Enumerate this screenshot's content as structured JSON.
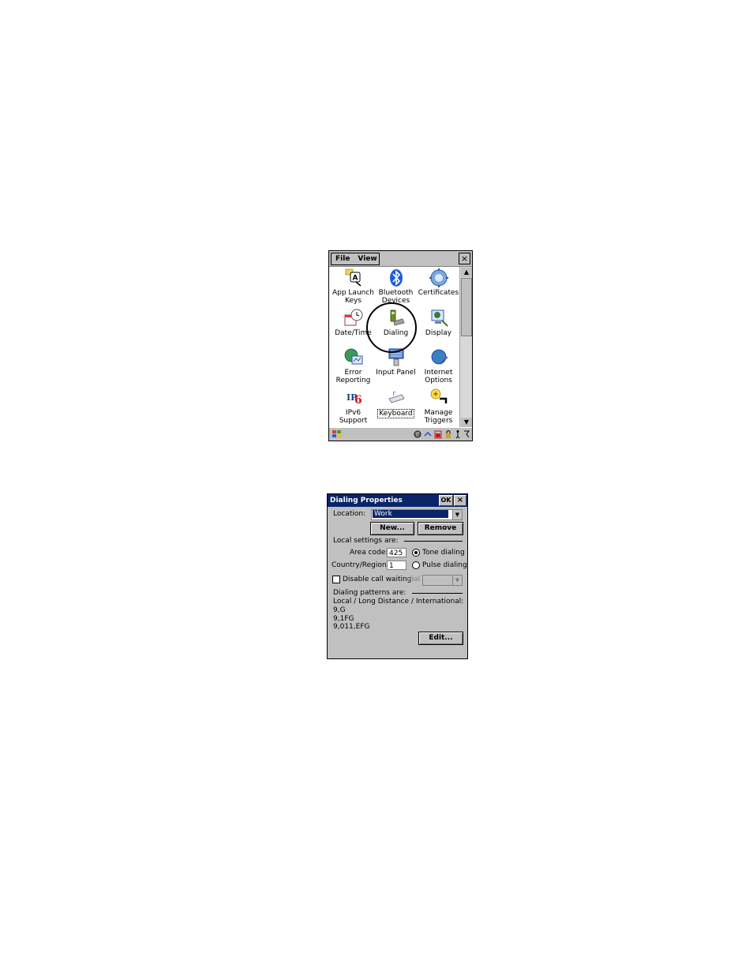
{
  "control_panel": {
    "menu": [
      "File",
      "View"
    ],
    "close_label": "×",
    "items": [
      {
        "label": "App Launch\nKeys",
        "icon": "app-launch-keys-icon"
      },
      {
        "label": "Bluetooth\nDevices",
        "icon": "bluetooth-icon"
      },
      {
        "label": "Certificates",
        "icon": "certificates-icon"
      },
      {
        "label": "Date/Time",
        "icon": "date-time-icon"
      },
      {
        "label": "Dialing",
        "icon": "dialing-icon"
      },
      {
        "label": "Display",
        "icon": "display-icon"
      },
      {
        "label": "Error\nReporting",
        "icon": "error-reporting-icon"
      },
      {
        "label": "Input Panel",
        "icon": "input-panel-icon"
      },
      {
        "label": "Internet\nOptions",
        "icon": "internet-options-icon"
      },
      {
        "label": "IPv6\nSupport",
        "icon": "ipv6-icon"
      },
      {
        "label": "Keyboard",
        "icon": "keyboard-icon"
      },
      {
        "label": "Manage\nTriggers",
        "icon": "manage-triggers-icon"
      }
    ]
  },
  "dialing": {
    "title": "Dialing Properties",
    "ok_label": "OK",
    "close_label": "×",
    "location_label": "Location:",
    "location_value": "Work",
    "new_button": "New...",
    "remove_button": "Remove",
    "local_settings_label": "Local settings are:",
    "area_code_label": "Area code:",
    "area_code_value": "425",
    "tone_label": "Tone dialing",
    "country_label": "Country/Region:",
    "country_value": "1",
    "pulse_label": "Pulse dialing",
    "disable_call_waiting_label": "Disable call waiting:",
    "dial_label": "dial",
    "patterns_label": "Dialing patterns are:",
    "patterns_header": "Local / Long Distance / International:",
    "pattern_local": "9,G",
    "pattern_long": "9,1FG",
    "pattern_intl": "9,011,EFG",
    "edit_button": "Edit..."
  }
}
